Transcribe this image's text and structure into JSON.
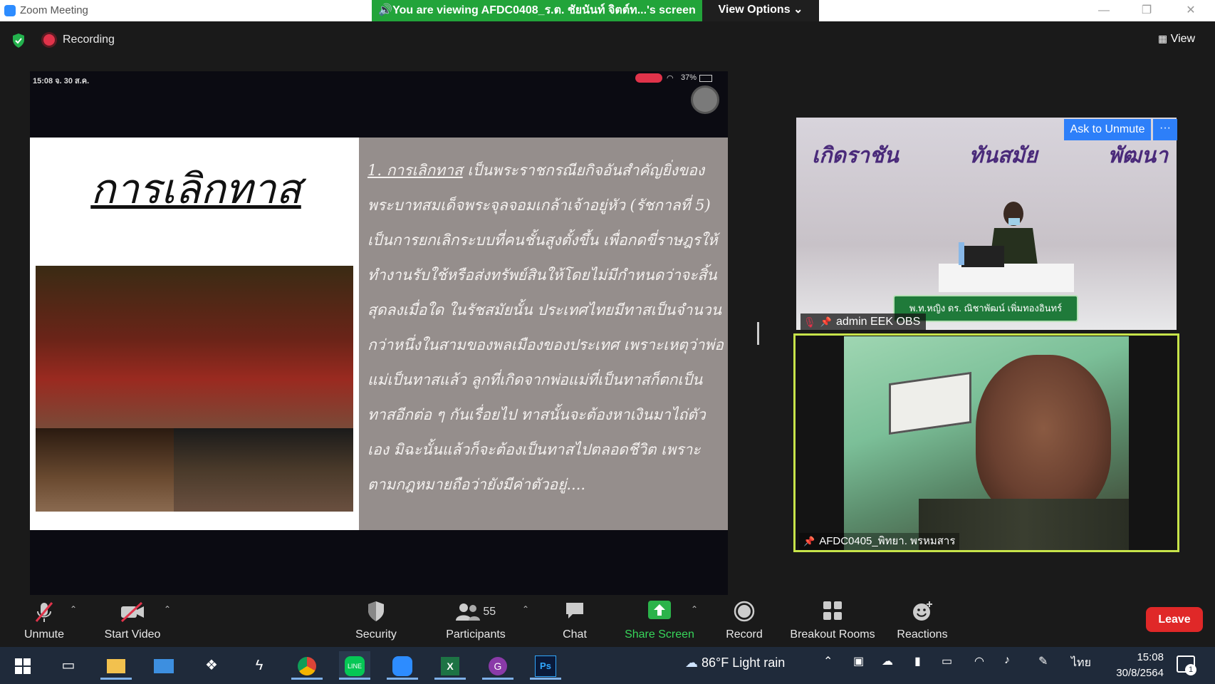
{
  "window": {
    "title": "Zoom Meeting",
    "viewing_banner": "🔊You are viewing AFDC0408_ร.ต. ชัยนันท์ จิตต์ท...'s screen",
    "view_options": "View Options ⌄",
    "minimize": "—",
    "restore": "❐",
    "close": "✕"
  },
  "topbar": {
    "recording_label": "Recording",
    "view_label": "View"
  },
  "shared_screen": {
    "ipad_time": "15:08  จ. 30 ส.ค.",
    "ipad_battery": "37%",
    "slide_title": "การเลิกทาส",
    "slide_heading": "1. การเลิกทาส",
    "slide_body": "เป็นพระราชกรณียกิจอันสำคัญยิ่งของพระบาทสมเด็จพระจุลจอมเกล้าเจ้าอยู่หัว (รัชกาลที่ 5) เป็นการยกเลิกระบบที่คนชั้นสูงตั้งขึ้น เพื่อกดขี่ราษฎรให้ทำงานรับใช้หรือส่งทรัพย์สินให้โดยไม่มีกำหนดว่าจะสิ้นสุดลงเมื่อใด ในรัชสมัยนั้น ประเทศไทยมีทาสเป็นจำนวนกว่าหนึ่งในสามของพลเมืองของประเทศ เพราะเหตุว่าพ่อแม่เป็นทาสแล้ว ลูกที่เกิดจากพ่อแม่ที่เป็นทาสก็ตกเป็นทาสอีกต่อ ๆ กันเรื่อยไป ทาสนั้นจะต้องหาเงินมาไถ่ตัวเอง มิฉะนั้นแล้วก็จะต้องเป็นทาสไปตลอดชีวิต เพราะตามกฎหมายถือว่ายังมีค่าตัวอยู่...."
  },
  "tiles": [
    {
      "banner_words": [
        "เกิดราชัน",
        "ทันสมัย",
        "พัฒนา"
      ],
      "nameplate": "พ.ท.หญิง ดร. ณิชาพัฒน์ เพิ่มทองอินทร์",
      "ask_to_unmute": "Ask to Unmute",
      "more": "···",
      "name": "admin EEK OBS"
    },
    {
      "name": "AFDC0405_พิทยา. พรหมสาร"
    }
  ],
  "toolbar": {
    "unmute": "Unmute",
    "start_video": "Start Video",
    "security": "Security",
    "participants": "Participants",
    "participants_count": "55",
    "chat": "Chat",
    "share_screen": "Share Screen",
    "record": "Record",
    "breakout_rooms": "Breakout Rooms",
    "reactions": "Reactions",
    "leave": "Leave",
    "caret": "⌃"
  },
  "taskbar": {
    "weather_temp": "86°F",
    "weather_desc": "Light rain",
    "language": "ไทย",
    "time": "15:08",
    "date": "30/8/2564",
    "notification_count": "1"
  },
  "colors": {
    "share_green": "#22a43a",
    "leave_red": "#e02828",
    "active_speaker": "#c7e44a",
    "zoom_blue": "#2d7ff9"
  }
}
